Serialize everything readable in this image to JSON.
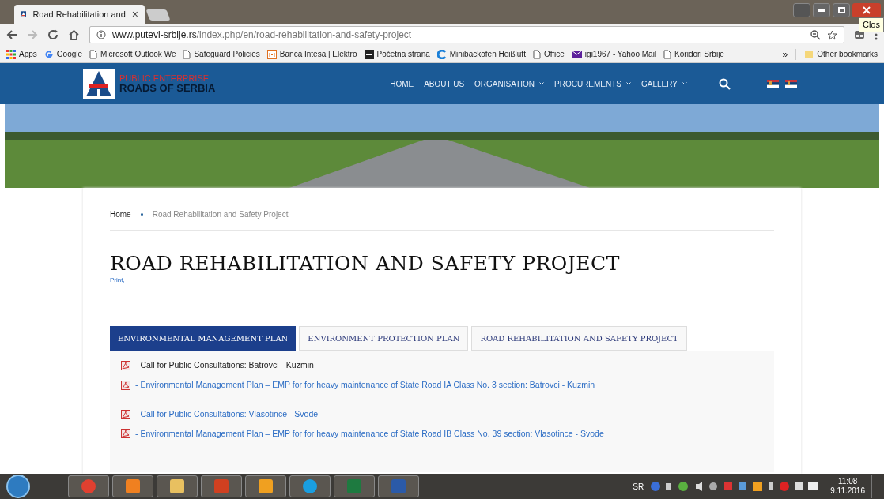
{
  "browser": {
    "tab": {
      "title": "Road Rehabilitation and",
      "close": "×"
    },
    "tooltip": "Clos",
    "address": {
      "host": "www.putevi-srbije.rs",
      "path": "/index.php/en/road-rehabilitation-and-safety-project"
    },
    "bookmarks": [
      {
        "label": "Apps",
        "kind": "apps"
      },
      {
        "label": "Google",
        "kind": "google"
      },
      {
        "label": "Microsoft Outlook We",
        "kind": "page"
      },
      {
        "label": "Safeguard Policies",
        "kind": "page"
      },
      {
        "label": "Banca Intesa | Elektro",
        "kind": "bank"
      },
      {
        "label": "Početna strana",
        "kind": "dark"
      },
      {
        "label": "Minibackofen Heißluft",
        "kind": "shop"
      },
      {
        "label": "Office",
        "kind": "page"
      },
      {
        "label": "igi1967 - Yahoo Mail",
        "kind": "mail"
      },
      {
        "label": "Koridori Srbije",
        "kind": "page"
      }
    ],
    "more": "»",
    "other": "Other bookmarks"
  },
  "site": {
    "logo": {
      "line1": "PUBLIC ENTERPRISE",
      "line2": "ROADS OF SERBIA"
    },
    "nav": [
      {
        "label": "HOME",
        "dropdown": false
      },
      {
        "label": "ABOUT US",
        "dropdown": false
      },
      {
        "label": "ORGANISATION",
        "dropdown": true
      },
      {
        "label": "PROCUREMENTS",
        "dropdown": true
      },
      {
        "label": "GALLERY",
        "dropdown": true
      }
    ],
    "breadcrumb": [
      "Home",
      "Road Rehabilitation and Safety Project"
    ],
    "title": "ROAD REHABILITATION AND SAFETY PROJECT",
    "print": "Print,",
    "tabs": [
      {
        "label": "ENVIRONMENTAL MANAGEMENT PLAN",
        "selected": true
      },
      {
        "label": "ENVIRONMENT PROTECTION PLAN",
        "selected": false
      },
      {
        "label": "ROAD REHABILITATION AND SAFETY PROJECT",
        "selected": false
      }
    ],
    "groups": [
      [
        {
          "text": "- Call for Public Consultations: Batrovci - Kuzmin",
          "kind": "text"
        },
        {
          "text": "- Environmental Management Plan – EMP for for heavy maintenance of State Road IA Class No. 3 section: Batrovci - Kuzmin",
          "kind": "link"
        }
      ],
      [
        {
          "text": "- Call for Public Consultations: Vlasotince - Svođe",
          "kind": "link"
        },
        {
          "text": "- Environmental Management Plan – EMP for for heavy maintenance of State Road IB Class No. 39 section: Vlasotince - Svođe",
          "kind": "link"
        }
      ]
    ]
  },
  "taskbar": {
    "apps": [
      {
        "kind": "chrome"
      },
      {
        "kind": "media"
      },
      {
        "kind": "folder"
      },
      {
        "kind": "slides"
      },
      {
        "kind": "outlook"
      },
      {
        "kind": "skype"
      },
      {
        "kind": "excel"
      },
      {
        "kind": "word"
      }
    ],
    "lang": "SR",
    "time": "11:08",
    "date": "9.11.2016"
  }
}
